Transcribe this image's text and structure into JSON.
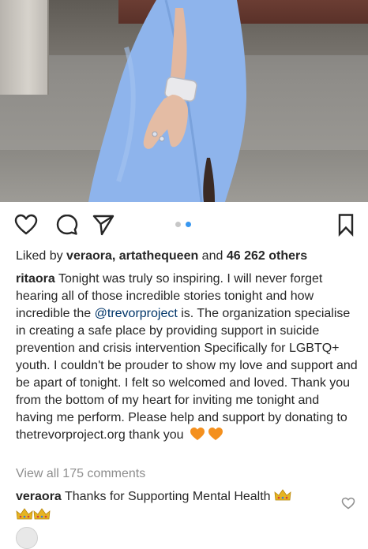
{
  "post": {
    "liked_by_prefix": "Liked by ",
    "liked_user_1": "veraora",
    "liked_sep": ", ",
    "liked_user_2": "artathequeen",
    "liked_and": " and ",
    "liked_count": "46 262 others",
    "author": "ritaora",
    "caption_part1": " Tonight was truly so inspiring. I will never forget hearing all of those incredible stories tonight and how incredible the ",
    "caption_mention": "@trevorproject",
    "caption_part2": " is. The organization specialise in creating a safe place by providing support in suicide prevention and crisis intervention Specifically for LGBTQ+ youth. I couldn't be prouder to show my love and support and be apart of tonight. I felt so welcomed and loved. Thank you from the bottom of my heart for inviting me tonight and having me perform. Please help and support by donating to thetrevorproject.org thank you",
    "view_all_comments": "View all 175 comments",
    "carousel": {
      "count": 2,
      "active_index": 1
    }
  },
  "comment": {
    "author": "veraora",
    "text": " Thanks for Supporting Mental Health "
  },
  "icons": {
    "like": "heart-outline-icon",
    "comment": "speech-bubble-icon",
    "share": "paper-plane-icon",
    "save": "bookmark-icon",
    "emoji_heart": "orange-heart-emoji",
    "emoji_crown": "crown-emoji"
  },
  "colors": {
    "dress": "#8eb4ec",
    "mention": "#003569",
    "active_dot": "#3897f0",
    "inactive_dot": "#c7c7c7",
    "orange_heart": "#f4901e",
    "crown": "#e6b422"
  }
}
